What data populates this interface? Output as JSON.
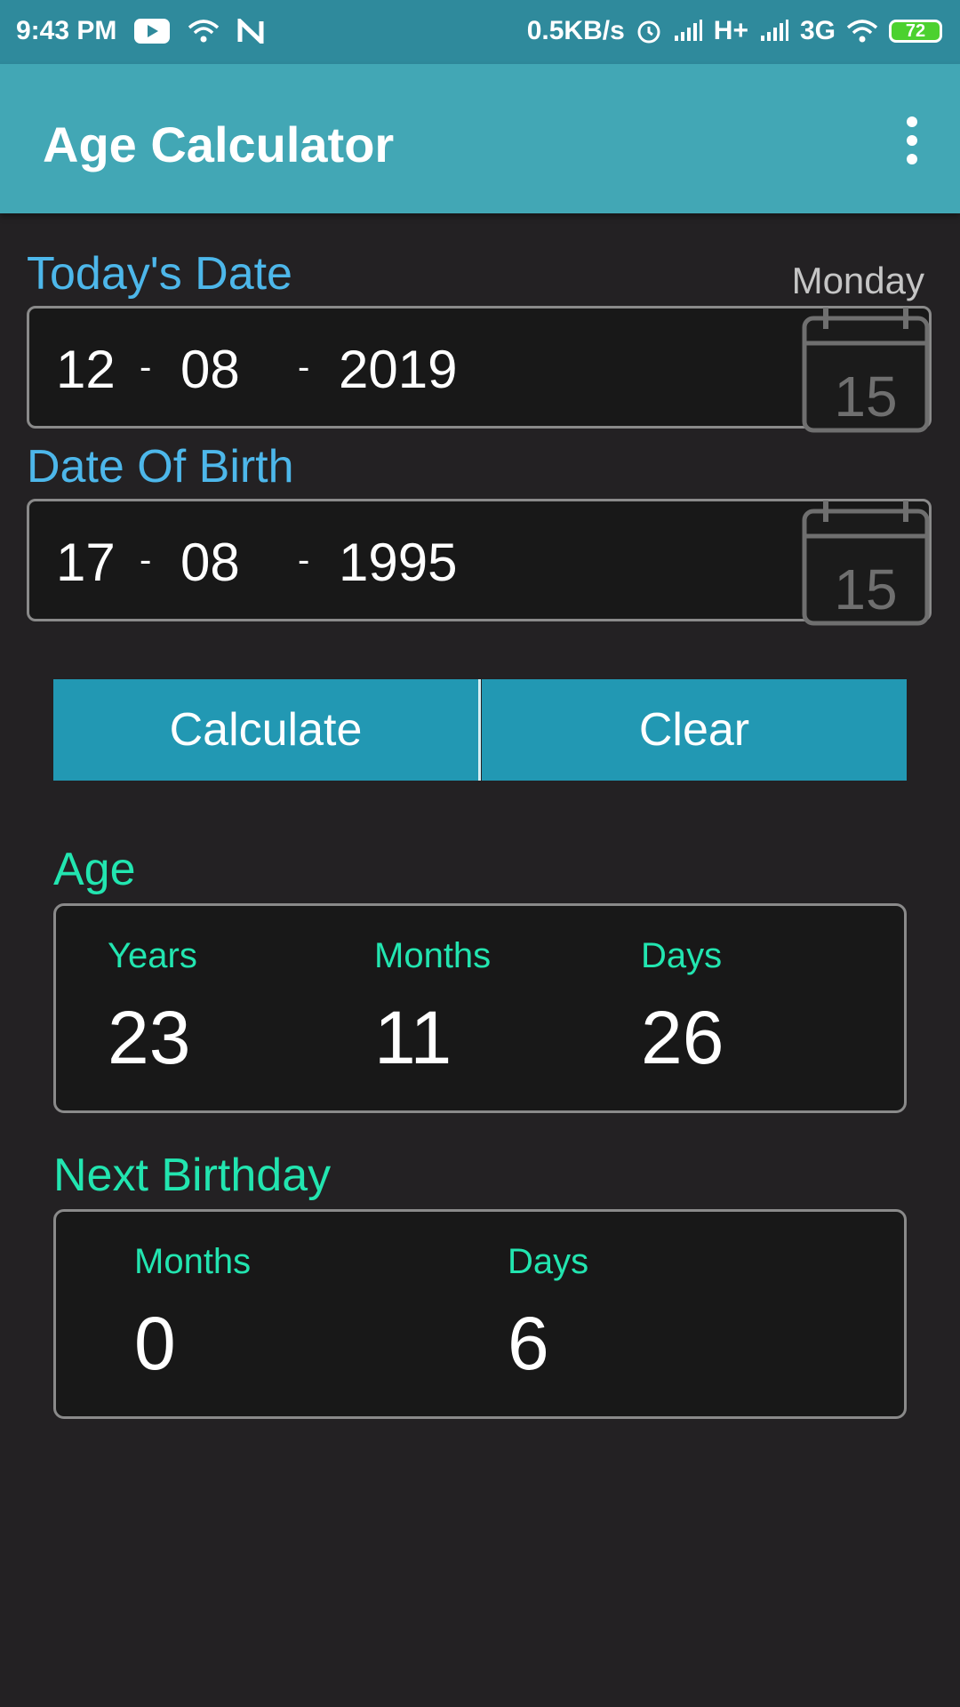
{
  "status_bar": {
    "time": "9:43 PM",
    "speed": "0.5KB/s",
    "network1": "H+",
    "network2": "3G",
    "battery": "72",
    "icons": [
      "youtube-icon",
      "wifi-icon",
      "n-icon",
      "alarm-icon",
      "signal-icon",
      "wifi-icon",
      "battery-icon"
    ]
  },
  "app_bar": {
    "title": "Age Calculator",
    "menu_icon": "more-vert-icon"
  },
  "today": {
    "label": "Today's Date",
    "weekday": "Monday",
    "day": "12",
    "month": "08",
    "year": "2019",
    "calendar_number": "15"
  },
  "birth": {
    "label": "Date Of Birth",
    "day": "17",
    "month": "08",
    "year": "1995",
    "calendar_number": "15"
  },
  "separator": "-",
  "buttons": {
    "calculate": "Calculate",
    "clear": "Clear"
  },
  "age": {
    "label": "Age",
    "years_label": "Years",
    "years": "23",
    "months_label": "Months",
    "months": "11",
    "days_label": "Days",
    "days": "26"
  },
  "next_birthday": {
    "label": "Next Birthday",
    "months_label": "Months",
    "months": "0",
    "days_label": "Days",
    "days": "6"
  },
  "colors": {
    "status_bar": "#2f8a9c",
    "app_bar": "#42a7b5",
    "background": "#232123",
    "blue_label": "#4db7ea",
    "green_label": "#22e5b0",
    "button": "#2298b3"
  }
}
